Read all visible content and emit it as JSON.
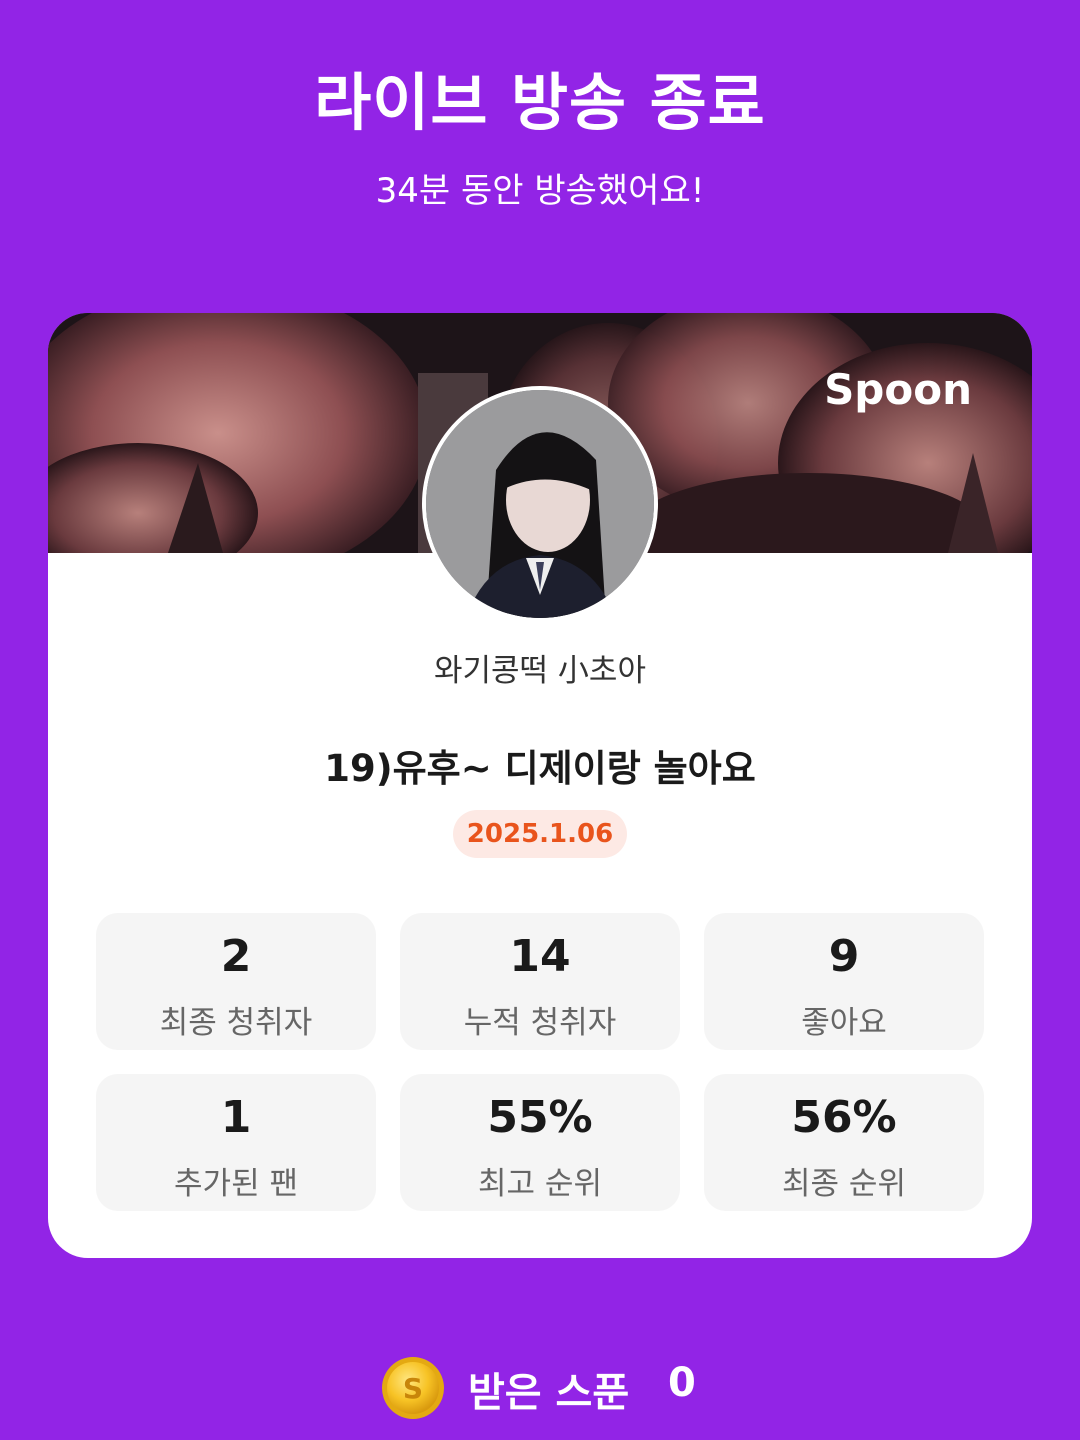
{
  "header": {
    "title": "라이브 방송 종료",
    "subtitle": "34분 동안 방송했어요!"
  },
  "card": {
    "brand": "Spoon",
    "nickname": "와기콩떡 小초아",
    "live_title": "19)유후~ 디제이랑 놀아요",
    "date": "2025.1.06",
    "stats": [
      {
        "value": "2",
        "label": "최종 청취자"
      },
      {
        "value": "14",
        "label": "누적 청취자"
      },
      {
        "value": "9",
        "label": "좋아요"
      },
      {
        "value": "1",
        "label": "추가된 팬"
      },
      {
        "value": "55%",
        "label": "최고 순위"
      },
      {
        "value": "56%",
        "label": "최종 순위"
      }
    ]
  },
  "footer": {
    "label": "받은 스푼",
    "count": "0",
    "icon": "spoon-coin-icon"
  },
  "colors": {
    "background": "#9224E6",
    "badge_bg": "#FDE9E4",
    "badge_text": "#E9541C",
    "stat_bg": "#F5F5F5"
  }
}
